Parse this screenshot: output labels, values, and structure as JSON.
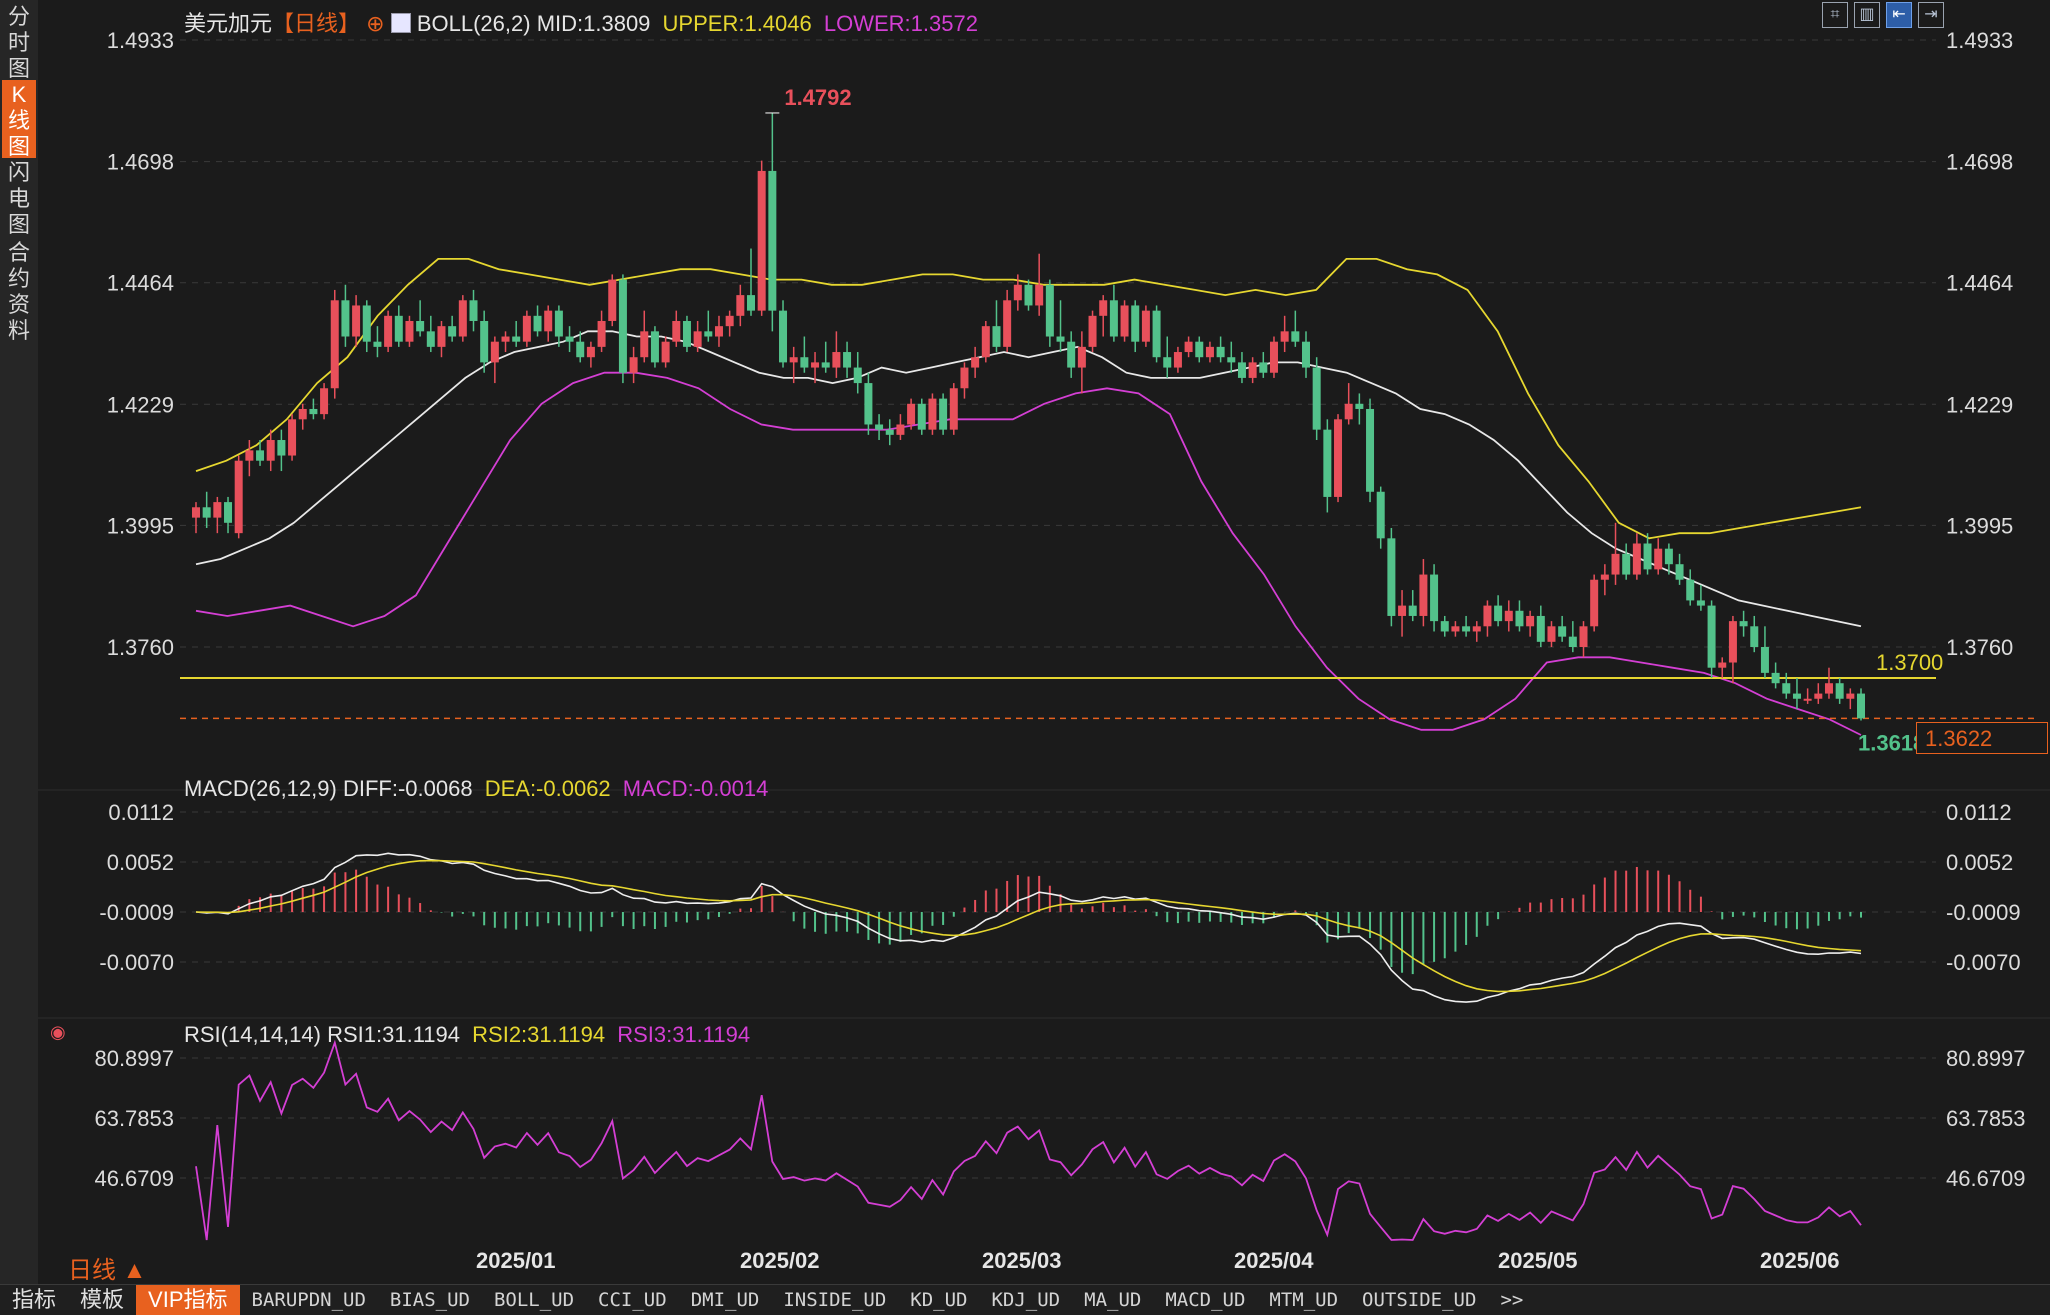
{
  "sidebar": {
    "tabs": [
      {
        "label": "分\n时\n图",
        "active": false
      },
      {
        "label": "K\n线\n图",
        "active": true
      },
      {
        "label": "闪\n电\n图",
        "active": false
      },
      {
        "label": "合\n约\n资\n料",
        "active": false
      }
    ]
  },
  "header": {
    "title": "美元加元",
    "period": "【日线】",
    "boll_label": "BOLL(26,2)",
    "mid": "MID:1.3809",
    "upper": "UPPER:1.4046",
    "lower": "LOWER:1.3572"
  },
  "main_axis": {
    "ticks": [
      "1.4933",
      "1.4698",
      "1.4464",
      "1.4229",
      "1.3995",
      "1.3760"
    ],
    "tick_values": [
      1.4933,
      1.4698,
      1.4464,
      1.4229,
      1.3995,
      1.376
    ]
  },
  "annotations": {
    "high": "1.4792",
    "hline": "1.3700",
    "last_low": "1.3618",
    "current_price": "1.3622"
  },
  "macd": {
    "header": "MACD(26,12,9)",
    "diff": "DIFF:-0.0068",
    "dea": "DEA:-0.0062",
    "macd": "MACD:-0.0014",
    "ticks": [
      "0.0112",
      "0.0052",
      "-0.0009",
      "-0.0070"
    ]
  },
  "rsi": {
    "header": "RSI(14,14,14)",
    "rsi1": "RSI1:31.1194",
    "rsi2": "RSI2:31.1194",
    "rsi3": "RSI3:31.1194",
    "ticks": [
      "80.8997",
      "63.7853",
      "46.6709"
    ]
  },
  "x_axis": {
    "labels": [
      "2025/01",
      "2025/02",
      "2025/03",
      "2025/04",
      "2025/05",
      "2025/06"
    ]
  },
  "period_label": "日线 ▲",
  "bottom_bar": {
    "items": [
      "指标",
      "模板",
      "VIP指标",
      "BARUPDN_UD",
      "BIAS_UD",
      "BOLL_UD",
      "CCI_UD",
      "DMI_UD",
      "INSIDE_UD",
      "KD_UD",
      "KDJ_UD",
      "MA_UD",
      "MACD_UD",
      "MTM_UD",
      "OUTSIDE_UD",
      ">>"
    ]
  },
  "colors": {
    "up": "#e8505b",
    "down": "#53c28b",
    "mid_line": "#e8e8e8",
    "upper_line": "#e6d730",
    "lower_line": "#d43fd4",
    "hline": "#e6d730",
    "accent": "#e8611f"
  },
  "chart_data": {
    "type": "candlestick",
    "symbol": "美元加元",
    "y_range": [
      1.355,
      1.4933
    ],
    "points": [
      {
        "o": 1.401,
        "h": 1.404,
        "l": 1.398,
        "c": 1.403
      },
      {
        "o": 1.403,
        "h": 1.406,
        "l": 1.399,
        "c": 1.401
      },
      {
        "o": 1.401,
        "h": 1.405,
        "l": 1.398,
        "c": 1.404
      },
      {
        "o": 1.404,
        "h": 1.405,
        "l": 1.398,
        "c": 1.4
      },
      {
        "o": 1.398,
        "h": 1.413,
        "l": 1.397,
        "c": 1.412
      },
      {
        "o": 1.412,
        "h": 1.416,
        "l": 1.409,
        "c": 1.414
      },
      {
        "o": 1.414,
        "h": 1.416,
        "l": 1.411,
        "c": 1.412
      },
      {
        "o": 1.412,
        "h": 1.418,
        "l": 1.41,
        "c": 1.416
      },
      {
        "o": 1.416,
        "h": 1.418,
        "l": 1.41,
        "c": 1.413
      },
      {
        "o": 1.413,
        "h": 1.421,
        "l": 1.412,
        "c": 1.42
      },
      {
        "o": 1.42,
        "h": 1.423,
        "l": 1.418,
        "c": 1.422
      },
      {
        "o": 1.422,
        "h": 1.424,
        "l": 1.42,
        "c": 1.421
      },
      {
        "o": 1.421,
        "h": 1.427,
        "l": 1.42,
        "c": 1.426
      },
      {
        "o": 1.426,
        "h": 1.445,
        "l": 1.424,
        "c": 1.443
      },
      {
        "o": 1.443,
        "h": 1.446,
        "l": 1.434,
        "c": 1.436
      },
      {
        "o": 1.436,
        "h": 1.444,
        "l": 1.434,
        "c": 1.442
      },
      {
        "o": 1.442,
        "h": 1.443,
        "l": 1.433,
        "c": 1.435
      },
      {
        "o": 1.435,
        "h": 1.438,
        "l": 1.432,
        "c": 1.434
      },
      {
        "o": 1.434,
        "h": 1.441,
        "l": 1.433,
        "c": 1.44
      },
      {
        "o": 1.44,
        "h": 1.442,
        "l": 1.434,
        "c": 1.435
      },
      {
        "o": 1.435,
        "h": 1.44,
        "l": 1.434,
        "c": 1.439
      },
      {
        "o": 1.439,
        "h": 1.443,
        "l": 1.436,
        "c": 1.437
      },
      {
        "o": 1.437,
        "h": 1.44,
        "l": 1.433,
        "c": 1.434
      },
      {
        "o": 1.434,
        "h": 1.439,
        "l": 1.432,
        "c": 1.438
      },
      {
        "o": 1.438,
        "h": 1.44,
        "l": 1.435,
        "c": 1.436
      },
      {
        "o": 1.436,
        "h": 1.444,
        "l": 1.435,
        "c": 1.443
      },
      {
        "o": 1.443,
        "h": 1.445,
        "l": 1.437,
        "c": 1.439
      },
      {
        "o": 1.439,
        "h": 1.441,
        "l": 1.429,
        "c": 1.431
      },
      {
        "o": 1.431,
        "h": 1.436,
        "l": 1.427,
        "c": 1.435
      },
      {
        "o": 1.435,
        "h": 1.437,
        "l": 1.433,
        "c": 1.436
      },
      {
        "o": 1.436,
        "h": 1.439,
        "l": 1.434,
        "c": 1.435
      },
      {
        "o": 1.435,
        "h": 1.441,
        "l": 1.434,
        "c": 1.44
      },
      {
        "o": 1.44,
        "h": 1.442,
        "l": 1.436,
        "c": 1.437
      },
      {
        "o": 1.437,
        "h": 1.442,
        "l": 1.435,
        "c": 1.441
      },
      {
        "o": 1.441,
        "h": 1.442,
        "l": 1.434,
        "c": 1.436
      },
      {
        "o": 1.436,
        "h": 1.438,
        "l": 1.433,
        "c": 1.435
      },
      {
        "o": 1.435,
        "h": 1.437,
        "l": 1.431,
        "c": 1.432
      },
      {
        "o": 1.432,
        "h": 1.435,
        "l": 1.43,
        "c": 1.434
      },
      {
        "o": 1.434,
        "h": 1.441,
        "l": 1.433,
        "c": 1.439
      },
      {
        "o": 1.439,
        "h": 1.448,
        "l": 1.438,
        "c": 1.447
      },
      {
        "o": 1.447,
        "h": 1.448,
        "l": 1.427,
        "c": 1.429
      },
      {
        "o": 1.429,
        "h": 1.434,
        "l": 1.427,
        "c": 1.432
      },
      {
        "o": 1.432,
        "h": 1.441,
        "l": 1.431,
        "c": 1.437
      },
      {
        "o": 1.437,
        "h": 1.438,
        "l": 1.43,
        "c": 1.431
      },
      {
        "o": 1.431,
        "h": 1.436,
        "l": 1.43,
        "c": 1.435
      },
      {
        "o": 1.435,
        "h": 1.441,
        "l": 1.434,
        "c": 1.439
      },
      {
        "o": 1.439,
        "h": 1.44,
        "l": 1.433,
        "c": 1.434
      },
      {
        "o": 1.434,
        "h": 1.439,
        "l": 1.433,
        "c": 1.437
      },
      {
        "o": 1.437,
        "h": 1.441,
        "l": 1.435,
        "c": 1.436
      },
      {
        "o": 1.436,
        "h": 1.44,
        "l": 1.434,
        "c": 1.438
      },
      {
        "o": 1.438,
        "h": 1.441,
        "l": 1.436,
        "c": 1.44
      },
      {
        "o": 1.44,
        "h": 1.446,
        "l": 1.438,
        "c": 1.444
      },
      {
        "o": 1.444,
        "h": 1.453,
        "l": 1.44,
        "c": 1.441
      },
      {
        "o": 1.441,
        "h": 1.47,
        "l": 1.44,
        "c": 1.468
      },
      {
        "o": 1.468,
        "h": 1.4792,
        "l": 1.437,
        "c": 1.441
      },
      {
        "o": 1.441,
        "h": 1.443,
        "l": 1.43,
        "c": 1.431
      },
      {
        "o": 1.431,
        "h": 1.434,
        "l": 1.427,
        "c": 1.432
      },
      {
        "o": 1.432,
        "h": 1.436,
        "l": 1.429,
        "c": 1.43
      },
      {
        "o": 1.43,
        "h": 1.433,
        "l": 1.427,
        "c": 1.431
      },
      {
        "o": 1.431,
        "h": 1.435,
        "l": 1.429,
        "c": 1.43
      },
      {
        "o": 1.43,
        "h": 1.437,
        "l": 1.428,
        "c": 1.433
      },
      {
        "o": 1.433,
        "h": 1.435,
        "l": 1.428,
        "c": 1.43
      },
      {
        "o": 1.43,
        "h": 1.433,
        "l": 1.425,
        "c": 1.427
      },
      {
        "o": 1.427,
        "h": 1.429,
        "l": 1.417,
        "c": 1.419
      },
      {
        "o": 1.419,
        "h": 1.421,
        "l": 1.416,
        "c": 1.418
      },
      {
        "o": 1.418,
        "h": 1.42,
        "l": 1.415,
        "c": 1.417
      },
      {
        "o": 1.417,
        "h": 1.421,
        "l": 1.416,
        "c": 1.419
      },
      {
        "o": 1.419,
        "h": 1.424,
        "l": 1.418,
        "c": 1.423
      },
      {
        "o": 1.423,
        "h": 1.424,
        "l": 1.417,
        "c": 1.418
      },
      {
        "o": 1.418,
        "h": 1.425,
        "l": 1.417,
        "c": 1.424
      },
      {
        "o": 1.424,
        "h": 1.425,
        "l": 1.417,
        "c": 1.418
      },
      {
        "o": 1.418,
        "h": 1.427,
        "l": 1.417,
        "c": 1.426
      },
      {
        "o": 1.426,
        "h": 1.431,
        "l": 1.424,
        "c": 1.43
      },
      {
        "o": 1.43,
        "h": 1.434,
        "l": 1.428,
        "c": 1.432
      },
      {
        "o": 1.432,
        "h": 1.439,
        "l": 1.431,
        "c": 1.438
      },
      {
        "o": 1.438,
        "h": 1.443,
        "l": 1.433,
        "c": 1.434
      },
      {
        "o": 1.434,
        "h": 1.445,
        "l": 1.433,
        "c": 1.443
      },
      {
        "o": 1.443,
        "h": 1.448,
        "l": 1.441,
        "c": 1.446
      },
      {
        "o": 1.446,
        "h": 1.447,
        "l": 1.441,
        "c": 1.442
      },
      {
        "o": 1.442,
        "h": 1.452,
        "l": 1.44,
        "c": 1.446
      },
      {
        "o": 1.446,
        "h": 1.447,
        "l": 1.434,
        "c": 1.436
      },
      {
        "o": 1.436,
        "h": 1.443,
        "l": 1.433,
        "c": 1.435
      },
      {
        "o": 1.435,
        "h": 1.437,
        "l": 1.428,
        "c": 1.43
      },
      {
        "o": 1.43,
        "h": 1.437,
        "l": 1.425,
        "c": 1.434
      },
      {
        "o": 1.434,
        "h": 1.441,
        "l": 1.433,
        "c": 1.44
      },
      {
        "o": 1.44,
        "h": 1.444,
        "l": 1.436,
        "c": 1.443
      },
      {
        "o": 1.443,
        "h": 1.446,
        "l": 1.435,
        "c": 1.436
      },
      {
        "o": 1.436,
        "h": 1.443,
        "l": 1.435,
        "c": 1.442
      },
      {
        "o": 1.442,
        "h": 1.443,
        "l": 1.433,
        "c": 1.435
      },
      {
        "o": 1.435,
        "h": 1.442,
        "l": 1.434,
        "c": 1.441
      },
      {
        "o": 1.441,
        "h": 1.442,
        "l": 1.431,
        "c": 1.432
      },
      {
        "o": 1.432,
        "h": 1.436,
        "l": 1.428,
        "c": 1.43
      },
      {
        "o": 1.43,
        "h": 1.434,
        "l": 1.429,
        "c": 1.433
      },
      {
        "o": 1.433,
        "h": 1.436,
        "l": 1.432,
        "c": 1.435
      },
      {
        "o": 1.435,
        "h": 1.436,
        "l": 1.431,
        "c": 1.432
      },
      {
        "o": 1.432,
        "h": 1.435,
        "l": 1.431,
        "c": 1.434
      },
      {
        "o": 1.434,
        "h": 1.436,
        "l": 1.431,
        "c": 1.432
      },
      {
        "o": 1.432,
        "h": 1.435,
        "l": 1.429,
        "c": 1.431
      },
      {
        "o": 1.431,
        "h": 1.433,
        "l": 1.427,
        "c": 1.428
      },
      {
        "o": 1.428,
        "h": 1.432,
        "l": 1.427,
        "c": 1.431
      },
      {
        "o": 1.431,
        "h": 1.433,
        "l": 1.428,
        "c": 1.429
      },
      {
        "o": 1.429,
        "h": 1.436,
        "l": 1.428,
        "c": 1.435
      },
      {
        "o": 1.435,
        "h": 1.44,
        "l": 1.433,
        "c": 1.437
      },
      {
        "o": 1.437,
        "h": 1.441,
        "l": 1.434,
        "c": 1.435
      },
      {
        "o": 1.435,
        "h": 1.437,
        "l": 1.428,
        "c": 1.43
      },
      {
        "o": 1.43,
        "h": 1.432,
        "l": 1.416,
        "c": 1.418
      },
      {
        "o": 1.418,
        "h": 1.42,
        "l": 1.402,
        "c": 1.405
      },
      {
        "o": 1.405,
        "h": 1.421,
        "l": 1.404,
        "c": 1.42
      },
      {
        "o": 1.42,
        "h": 1.427,
        "l": 1.419,
        "c": 1.423
      },
      {
        "o": 1.423,
        "h": 1.425,
        "l": 1.419,
        "c": 1.422
      },
      {
        "o": 1.422,
        "h": 1.424,
        "l": 1.404,
        "c": 1.406
      },
      {
        "o": 1.406,
        "h": 1.407,
        "l": 1.395,
        "c": 1.397
      },
      {
        "o": 1.397,
        "h": 1.399,
        "l": 1.38,
        "c": 1.382
      },
      {
        "o": 1.382,
        "h": 1.387,
        "l": 1.378,
        "c": 1.384
      },
      {
        "o": 1.384,
        "h": 1.387,
        "l": 1.381,
        "c": 1.382
      },
      {
        "o": 1.382,
        "h": 1.393,
        "l": 1.38,
        "c": 1.39
      },
      {
        "o": 1.39,
        "h": 1.392,
        "l": 1.379,
        "c": 1.381
      },
      {
        "o": 1.381,
        "h": 1.382,
        "l": 1.378,
        "c": 1.379
      },
      {
        "o": 1.379,
        "h": 1.381,
        "l": 1.378,
        "c": 1.38
      },
      {
        "o": 1.38,
        "h": 1.382,
        "l": 1.378,
        "c": 1.379
      },
      {
        "o": 1.379,
        "h": 1.381,
        "l": 1.377,
        "c": 1.38
      },
      {
        "o": 1.38,
        "h": 1.385,
        "l": 1.378,
        "c": 1.384
      },
      {
        "o": 1.384,
        "h": 1.386,
        "l": 1.38,
        "c": 1.381
      },
      {
        "o": 1.381,
        "h": 1.385,
        "l": 1.379,
        "c": 1.383
      },
      {
        "o": 1.383,
        "h": 1.385,
        "l": 1.379,
        "c": 1.38
      },
      {
        "o": 1.38,
        "h": 1.383,
        "l": 1.378,
        "c": 1.382
      },
      {
        "o": 1.382,
        "h": 1.384,
        "l": 1.376,
        "c": 1.377
      },
      {
        "o": 1.377,
        "h": 1.381,
        "l": 1.376,
        "c": 1.38
      },
      {
        "o": 1.38,
        "h": 1.382,
        "l": 1.377,
        "c": 1.378
      },
      {
        "o": 1.378,
        "h": 1.381,
        "l": 1.375,
        "c": 1.376
      },
      {
        "o": 1.376,
        "h": 1.381,
        "l": 1.374,
        "c": 1.38
      },
      {
        "o": 1.38,
        "h": 1.39,
        "l": 1.379,
        "c": 1.389
      },
      {
        "o": 1.389,
        "h": 1.392,
        "l": 1.386,
        "c": 1.39
      },
      {
        "o": 1.39,
        "h": 1.4,
        "l": 1.388,
        "c": 1.394
      },
      {
        "o": 1.394,
        "h": 1.396,
        "l": 1.389,
        "c": 1.39
      },
      {
        "o": 1.39,
        "h": 1.398,
        "l": 1.389,
        "c": 1.396
      },
      {
        "o": 1.396,
        "h": 1.398,
        "l": 1.39,
        "c": 1.391
      },
      {
        "o": 1.391,
        "h": 1.397,
        "l": 1.39,
        "c": 1.395
      },
      {
        "o": 1.395,
        "h": 1.396,
        "l": 1.39,
        "c": 1.392
      },
      {
        "o": 1.392,
        "h": 1.394,
        "l": 1.388,
        "c": 1.389
      },
      {
        "o": 1.389,
        "h": 1.391,
        "l": 1.384,
        "c": 1.385
      },
      {
        "o": 1.385,
        "h": 1.388,
        "l": 1.383,
        "c": 1.384
      },
      {
        "o": 1.384,
        "h": 1.385,
        "l": 1.37,
        "c": 1.372
      },
      {
        "o": 1.372,
        "h": 1.374,
        "l": 1.37,
        "c": 1.373
      },
      {
        "o": 1.373,
        "h": 1.382,
        "l": 1.369,
        "c": 1.381
      },
      {
        "o": 1.381,
        "h": 1.383,
        "l": 1.378,
        "c": 1.38
      },
      {
        "o": 1.38,
        "h": 1.382,
        "l": 1.375,
        "c": 1.376
      },
      {
        "o": 1.376,
        "h": 1.38,
        "l": 1.37,
        "c": 1.371
      },
      {
        "o": 1.371,
        "h": 1.373,
        "l": 1.368,
        "c": 1.369
      },
      {
        "o": 1.369,
        "h": 1.371,
        "l": 1.366,
        "c": 1.367
      },
      {
        "o": 1.367,
        "h": 1.37,
        "l": 1.364,
        "c": 1.366
      },
      {
        "o": 1.366,
        "h": 1.368,
        "l": 1.365,
        "c": 1.366
      },
      {
        "o": 1.366,
        "h": 1.369,
        "l": 1.365,
        "c": 1.367
      },
      {
        "o": 1.367,
        "h": 1.372,
        "l": 1.366,
        "c": 1.369
      },
      {
        "o": 1.369,
        "h": 1.37,
        "l": 1.365,
        "c": 1.366
      },
      {
        "o": 1.366,
        "h": 1.368,
        "l": 1.364,
        "c": 1.367
      },
      {
        "o": 1.367,
        "h": 1.368,
        "l": 1.3618,
        "c": 1.3622
      }
    ],
    "boll_mid": [
      1.392,
      1.393,
      1.395,
      1.397,
      1.4,
      1.404,
      1.408,
      1.412,
      1.416,
      1.42,
      1.424,
      1.428,
      1.431,
      1.433,
      1.434,
      1.435,
      1.437,
      1.437,
      1.436,
      1.436,
      1.435,
      1.433,
      1.431,
      1.429,
      1.428,
      1.428,
      1.427,
      1.428,
      1.43,
      1.429,
      1.43,
      1.431,
      1.432,
      1.433,
      1.432,
      1.433,
      1.434,
      1.432,
      1.429,
      1.428,
      1.428,
      1.428,
      1.429,
      1.43,
      1.431,
      1.431,
      1.43,
      1.429,
      1.427,
      1.425,
      1.422,
      1.421,
      1.419,
      1.416,
      1.412,
      1.407,
      1.402,
      1.398,
      1.395,
      1.393,
      1.391,
      1.389,
      1.387,
      1.385,
      1.384,
      1.383,
      1.382,
      1.381,
      1.38
    ],
    "boll_upper": [
      1.41,
      1.412,
      1.415,
      1.42,
      1.427,
      1.432,
      1.44,
      1.446,
      1.451,
      1.451,
      1.449,
      1.448,
      1.447,
      1.446,
      1.447,
      1.448,
      1.449,
      1.449,
      1.448,
      1.447,
      1.447,
      1.446,
      1.446,
      1.447,
      1.448,
      1.448,
      1.447,
      1.447,
      1.446,
      1.446,
      1.446,
      1.447,
      1.446,
      1.445,
      1.444,
      1.445,
      1.444,
      1.445,
      1.451,
      1.451,
      1.449,
      1.448,
      1.445,
      1.437,
      1.425,
      1.415,
      1.408,
      1.4,
      1.397,
      1.398,
      1.398,
      1.399,
      1.4,
      1.401,
      1.402,
      1.403
    ],
    "boll_lower": [
      1.383,
      1.382,
      1.383,
      1.384,
      1.382,
      1.38,
      1.382,
      1.386,
      1.396,
      1.406,
      1.416,
      1.423,
      1.427,
      1.429,
      1.429,
      1.428,
      1.426,
      1.422,
      1.419,
      1.418,
      1.418,
      1.418,
      1.418,
      1.419,
      1.42,
      1.42,
      1.42,
      1.423,
      1.425,
      1.426,
      1.425,
      1.421,
      1.408,
      1.398,
      1.39,
      1.38,
      1.372,
      1.366,
      1.362,
      1.36,
      1.36,
      1.362,
      1.366,
      1.373,
      1.374,
      1.374,
      1.373,
      1.372,
      1.371,
      1.369,
      1.366,
      1.364,
      1.362,
      1.359
    ],
    "series_values": {
      "mid": 1.3809,
      "upper": 1.4046,
      "lower": 1.3572
    },
    "x_labels": [
      "2025/01",
      "2025/02",
      "2025/03",
      "2025/04",
      "2025/05",
      "2025/06"
    ]
  }
}
